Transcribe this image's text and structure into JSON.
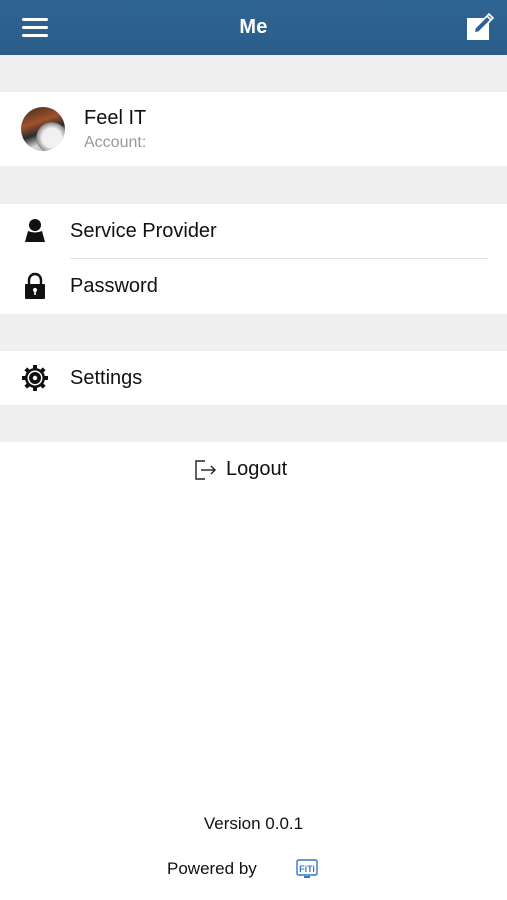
{
  "nav": {
    "title": "Me",
    "menu_icon": "hamburger-menu-icon",
    "edit_icon": "compose-icon",
    "background": "#2d6190"
  },
  "profile": {
    "name": "Feel IT",
    "account_label": "Account:"
  },
  "menu": {
    "items": [
      {
        "label": "Service Provider",
        "icon": "person-icon"
      },
      {
        "label": "Password",
        "icon": "lock-icon"
      },
      {
        "label": "Settings",
        "icon": "gear-icon"
      }
    ]
  },
  "logout": {
    "label": "Logout",
    "icon": "logout-icon"
  },
  "footer": {
    "version": "Version 0.0.1",
    "powered_by": "Powered by",
    "logo_icon": "fiti-logo-icon"
  },
  "colors": {
    "section_gap": "#efefef",
    "secondary_text": "#999999"
  }
}
